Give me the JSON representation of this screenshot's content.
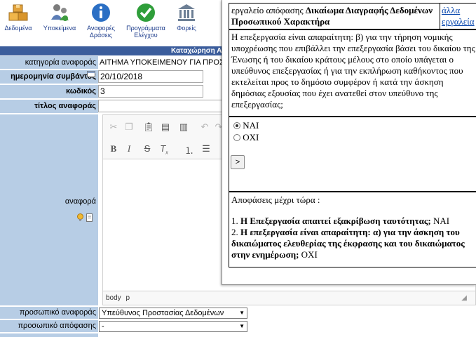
{
  "toolbar": {
    "items": [
      {
        "label": "Δεδομένα",
        "icon": "boxes-icon"
      },
      {
        "label": "Υποκείμενα",
        "icon": "users-icon"
      },
      {
        "label": "Αναφορές Δράσεις",
        "icon": "info-icon"
      },
      {
        "label": "Προγράμματα Ελέγχου",
        "icon": "checkmark-icon"
      },
      {
        "label": "Φορείς",
        "icon": "institution-icon"
      }
    ]
  },
  "title_bar": "Καταχώρηση Α",
  "form": {
    "category_label": "κατηγορία αναφοράς",
    "category_value": "ΑΙΤΗΜΑ ΥΠΟΚΕΙΜΕΝΟΥ ΓΙΑ ΠΡΟΣ",
    "date_label": "ημερομηνία συμβάντος",
    "date_value": "20/10/2018",
    "code_label": "κωδικός",
    "code_value": "3",
    "title_label": "τίτλος αναφοράς",
    "title_value": "",
    "report_label": "αναφορά",
    "staff_report_label": "προσωπικό αναφοράς",
    "staff_report_value": "Υπεύθυνος Προστασίας Δεδομένων",
    "staff_decision_label": "προσωπικό απόφασης",
    "staff_decision_value": "-"
  },
  "editor": {
    "status_items": [
      "body",
      "p"
    ]
  },
  "popup": {
    "tool_prefix": "εργαλείο απόφασης ",
    "tool_name": "Δικαίωμα Διαγραφής Δεδομένων Προσωπικού Χαρακτήρα",
    "other_tools_link": "άλλα εργαλεία",
    "question": "Η επεξεργασία είναι απαραίτητη: β) για την τήρηση νομικής υποχρέωσης που επιβάλλει την επεξεργασία βάσει του δικαίου της Ένωσης ή του δικαίου κράτους μέλους στο οποίο υπάγεται ο υπεύθυνος επεξεργασίας ή για την εκπλήρωση καθήκοντος που εκτελείται προς το δημόσιο συμφέρον ή κατά την άσκηση δημόσιας εξουσίας που έχει ανατεθεί στον υπεύθυνο της επεξεργασίας;",
    "options": [
      "ΝΑΙ",
      "ΟΧΙ"
    ],
    "selected_option": "ΝΑΙ",
    "next_button": ">",
    "decisions_title": "Αποφάσεις μέχρι τώρα :",
    "decisions": [
      {
        "num": "1.",
        "text": "Η Επεξεργασία απαιτεί εξακρίβωση ταυτότητας;",
        "answer": "ΝΑΙ"
      },
      {
        "num": "2.",
        "text": "Η επεξεργασία είναι απαραίτητη: α) για την άσκηση του δικαιώματος ελευθερίας της έκφρασης και του δικαιώματος στην ενημέρωση;",
        "answer": "ΟΧΙ"
      }
    ]
  },
  "colors": {
    "label_bg": "#b7cde5",
    "title_bar_bg": "#3b5d9c",
    "link": "#0645ad"
  }
}
